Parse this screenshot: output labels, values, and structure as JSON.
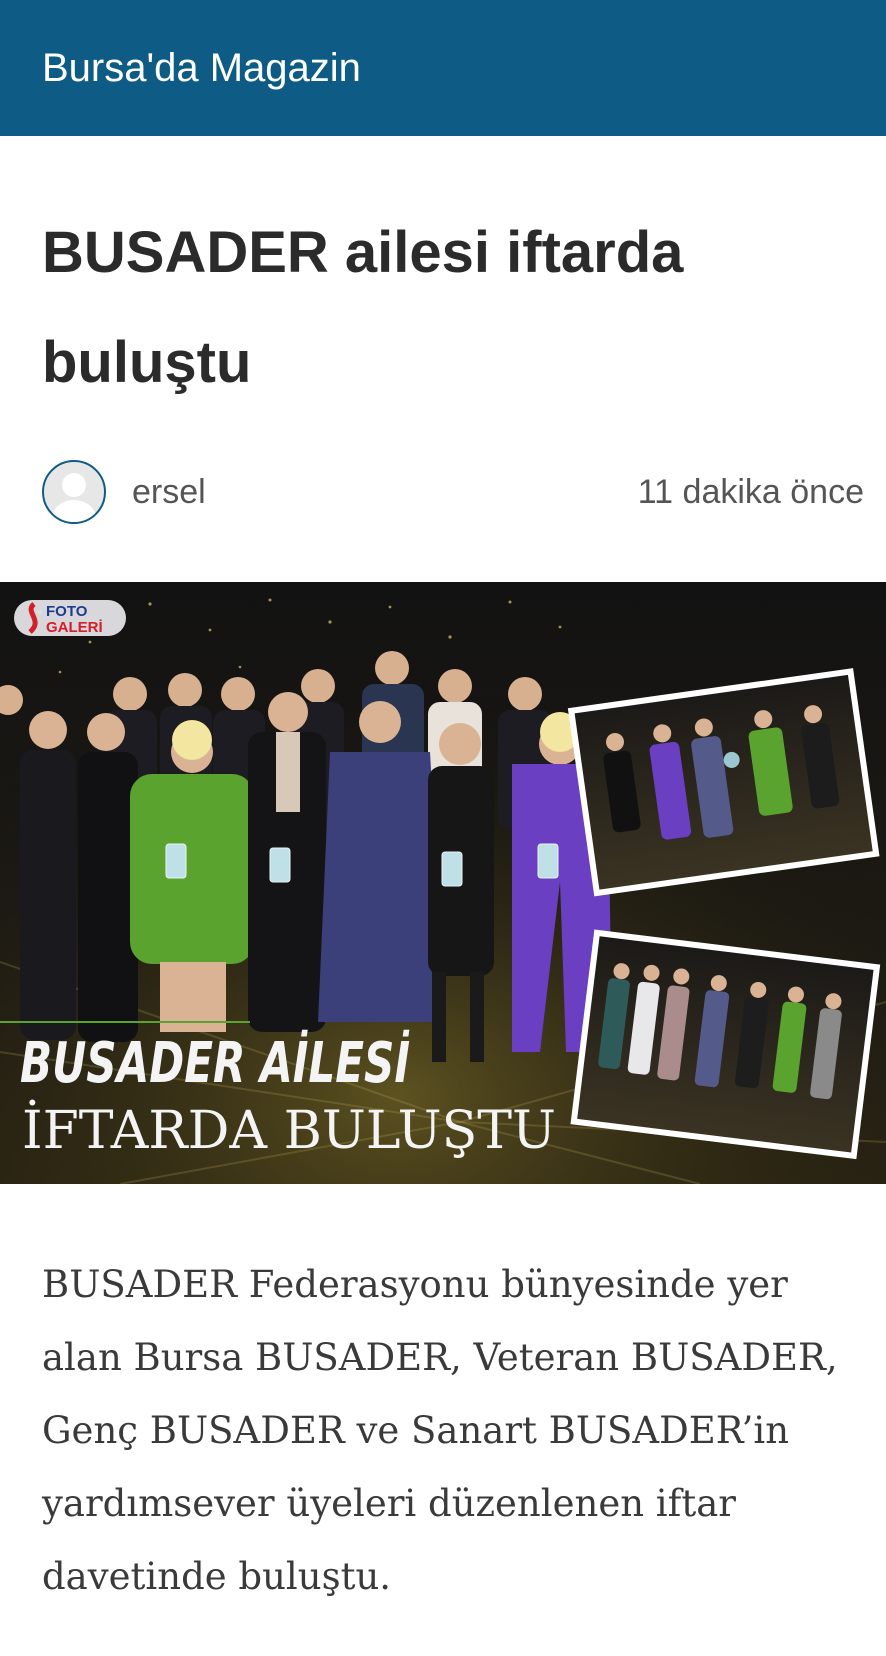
{
  "header": {
    "site_title": "Bursa'da Magazin",
    "background_color": "#0e5c85"
  },
  "article": {
    "title": "BUSADER ailesi iftarda buluştu",
    "author": "ersel",
    "timestamp": "11 dakika önce",
    "body": "BUSADER Federasyonu bünyesinde yer alan Bursa BUSADER, Veteran  BUSADER, Genç  BUSADER ve Sanart BUSADER’in yardımsever üyeleri düzenlenen iftar davetinde buluştu."
  },
  "hero_image": {
    "badge_line1": "FOTO",
    "badge_line2": "GALERİ",
    "headline_line1": "BUSADER AİLESİ",
    "headline_line2": "İFTARDA BULUŞTU"
  },
  "icons": {
    "avatar": "default-user-avatar-icon",
    "gallery": "photo-gallery-badge-icon"
  }
}
